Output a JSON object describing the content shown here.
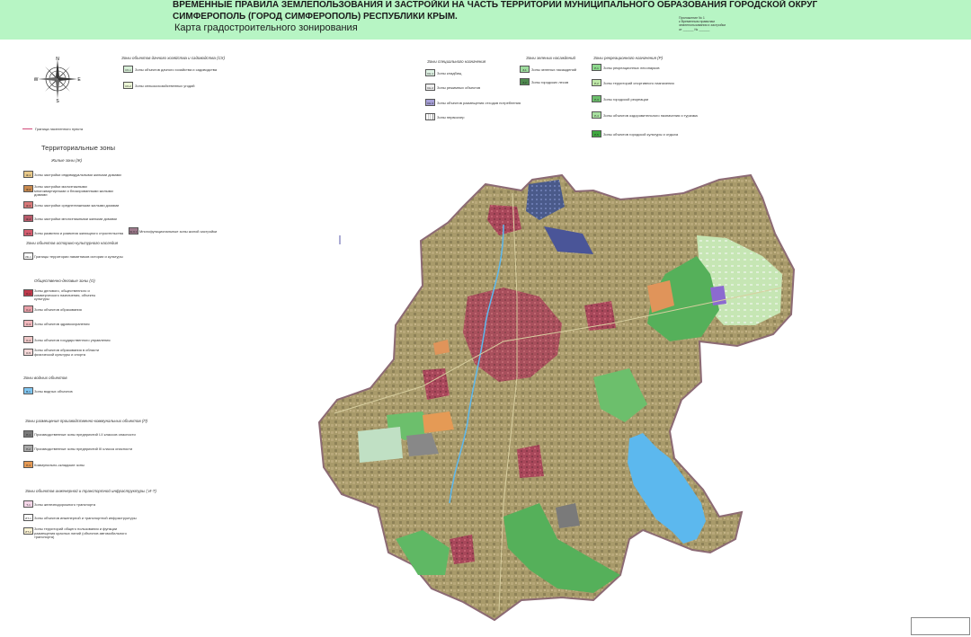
{
  "header": {
    "title_line1": "ВРЕМЕННЫЕ ПРАВИЛА ЗЕМЛЕПОЛЬЗОВАНИЯ И ЗАСТРОЙКИ НА ЧАСТЬ ТЕРРИТОРИИ МУНИЦИПАЛЬНОГО ОБРАЗОВАНИЯ ГОРОДСКОЙ ОКРУГ",
    "title_line2": "СИМФЕРОПОЛЬ (ГОРОД СИМФЕРОПОЛЬ) РЕСПУБЛИКИ КРЫМ.",
    "subtitle": "Карта градостроительного зонирования",
    "approval": [
      "Приложение № 1",
      "к Временным правилам",
      "землепользования и застройки",
      "от ______ № ______"
    ],
    "background": "#b7f5c4"
  },
  "compass": {
    "n": "N",
    "s": "S",
    "e": "E",
    "w": "W"
  },
  "legend": {
    "boundary": {
      "label": "Граница населенного пункта",
      "color": "#d24a7a"
    },
    "territorial_title": "Территориальные зоны",
    "residential": {
      "heading": "Жилые зоны (Ж)",
      "items": [
        {
          "code": "Ж-1",
          "label": "Зоны застройки индивидуальными жилыми домами",
          "color": "#e8c98a"
        },
        {
          "code": "Ж-2",
          "label": "Зоны застройки малоэтажными многоквартирными и блокированными жилыми домами",
          "color": "#c98a4e"
        },
        {
          "code": "Ж-3",
          "label": "Зоны застройки среднеэтажными жилыми домами",
          "color": "#d97a7a"
        },
        {
          "code": "Ж-4",
          "label": "Зоны застройки многоэтажными жилыми домами",
          "color": "#b85a6a"
        },
        {
          "code": "Ж-5",
          "label": "Зоны развития и развития жилищного строительства",
          "color": "#d65d6f"
        },
        {
          "code": "Ж-6.1",
          "label": "Многофункциональные зоны жилой застройки",
          "color": "#9e7a8c"
        }
      ]
    },
    "heritage": {
      "heading": "Зоны объектов историко-культурного наследия",
      "items": [
        {
          "code": "ИК-1",
          "label": "Границы территории памятников истории и культуры",
          "color": "#ffffff"
        }
      ]
    },
    "public": {
      "heading": "Общественно-деловые зоны (О)",
      "items": [
        {
          "code": "О-1",
          "label": "Зоны делового, общественного и коммерческого назначения, объекты культуры",
          "color": "#c0394b"
        },
        {
          "code": "О-2",
          "label": "Зоны объектов образования",
          "color": "#e9a0a8"
        },
        {
          "code": "О-3",
          "label": "Зоны объектов здравоохранения",
          "color": "#f2b8bd"
        },
        {
          "code": "О-4",
          "label": "Зоны объектов государственного управления",
          "color": "#f0c8c8"
        },
        {
          "code": "О-5",
          "label": "Зоны объектов образования в области физической культуры и спорта",
          "color": "#f5d8d8"
        }
      ]
    },
    "water": {
      "heading": "Зоны водных объектов",
      "items": [
        {
          "code": "В-1",
          "label": "Зоны водных объектов",
          "color": "#7fc6f2"
        }
      ]
    },
    "industrial": {
      "heading": "Зоны размещения производственно-коммунальных объектов (П)",
      "items": [
        {
          "code": "П-1",
          "label": "Производственные зоны предприятий I-II классов опасности",
          "color": "#7a7a7a"
        },
        {
          "code": "П-2",
          "label": "Производственные зоны предприятий III класса опасности",
          "color": "#a8a8a8"
        },
        {
          "code": "П-3",
          "label": "Коммунально-складские зоны",
          "color": "#e59a55"
        }
      ]
    },
    "infrastructure": {
      "heading": "Зоны объектов инженерной и транспортной инфраструктуры ( И-Т)",
      "items": [
        {
          "code": "Т-1",
          "label": "Зоны железнодорожного транспорта",
          "color": "#f4d6e8"
        },
        {
          "code": "ИТ-1",
          "label": "Зоны объектов инженерной и транспортной инфраструктуры",
          "color": "#ffffff"
        },
        {
          "code": "ИТ-2",
          "label": "Зоны территорий общего пользования и функции размещения красных линий (объектов автомобильного транспорта)",
          "color": "#fff6d6"
        }
      ]
    },
    "agricultural": {
      "heading": "Зоны объектов дачного хозяйства и садоводства (СХ)",
      "items": [
        {
          "code": "СХ-1",
          "label": "Зоны объектов дачного хозяйства и садоводства",
          "color": "#d8f0d8"
        },
        {
          "code": "СХ-2",
          "label": "Зоны сельскохозяйственных угодий",
          "color": "#ecf7d6"
        }
      ]
    },
    "special": {
      "heading": "Зоны специального назначения",
      "items": [
        {
          "code": "СН-1",
          "label": "Зоны кладбищ",
          "color": "#dff2e4"
        },
        {
          "code": "СН-2",
          "label": "Зоны режимных объектов",
          "color": "#eeeeee"
        },
        {
          "code": "СН-3",
          "label": "Зоны объектов размещения отходов потребления",
          "color": "#a7a0d8"
        },
        {
          "code": "",
          "label": "Зоны первоочер",
          "color": "#ffffff"
        }
      ]
    },
    "green": {
      "heading": "Зоны зеленых насаждений",
      "items": [
        {
          "code": "З-1",
          "label": "Зоны зеленых насаждений",
          "color": "#9edc9e"
        },
        {
          "code": "З-2",
          "label": "Зоны городских лесов",
          "color": "#4e8a4e"
        }
      ]
    },
    "recreational": {
      "heading": "Зоны рекреационного назначения (Р)",
      "items": [
        {
          "code": "Р-1",
          "label": "Зоны рекреационных лесопарков",
          "color": "#8ed98e"
        },
        {
          "code": "Р-2",
          "label": "Зоны территорий спортивного назначения",
          "color": "#bfe8a8"
        },
        {
          "code": "Р-3",
          "label": "Зоны городской рекреации",
          "color": "#6cbf6c"
        },
        {
          "code": "Р-4",
          "label": "Зоны объектов оздоровительного назначения и туризма",
          "color": "#a8e0a0"
        },
        {
          "code": "Р-5",
          "label": "Зоны объектов городской культуры и отдыха",
          "color": "#3fa83f"
        }
      ]
    }
  },
  "map_colors": {
    "boundary": "#8c6a74",
    "base": "#9c8f64",
    "residential": "#b8a06a",
    "dense": "#a8475a",
    "green": "#55b05a",
    "light_green": "#c6e6b4",
    "water": "#5cb8ee",
    "industrial": "#888888",
    "orange": "#e0945a"
  }
}
